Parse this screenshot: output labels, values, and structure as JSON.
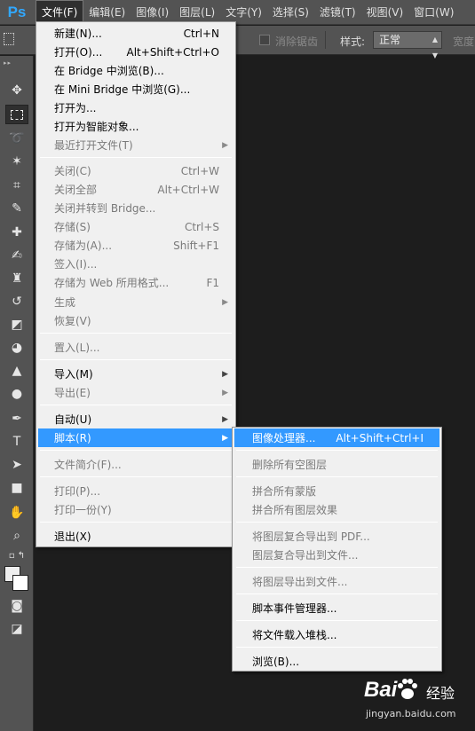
{
  "app": {
    "logo": "Ps"
  },
  "menubar": {
    "items": [
      "文件(F)",
      "编辑(E)",
      "图像(I)",
      "图层(L)",
      "文字(Y)",
      "选择(S)",
      "滤镜(T)",
      "视图(V)",
      "窗口(W)"
    ]
  },
  "options": {
    "antialias_label": "消除锯齿",
    "style_label": "样式:",
    "style_value": "正常",
    "width_label": "宽度"
  },
  "toolbox": {
    "icons": [
      "move-icon",
      "marquee-icon",
      "lasso-icon",
      "magic-wand-icon",
      "crop-icon",
      "eyedropper-icon",
      "healing-brush-icon",
      "brush-icon",
      "clone-stamp-icon",
      "history-brush-icon",
      "eraser-icon",
      "paint-bucket-icon",
      "blur-icon",
      "dodge-icon",
      "pen-icon",
      "type-icon",
      "path-selection-icon",
      "rectangle-icon",
      "hand-icon",
      "zoom-icon",
      "swap-colors-icon",
      "quick-mask-icon",
      "screen-mode-icon"
    ],
    "foreground_color": "#eeeeee",
    "background_color": "#ffffff"
  },
  "file_menu": {
    "items": [
      {
        "label": "新建(N)...",
        "shortcut": "Ctrl+N",
        "enabled": true
      },
      {
        "label": "打开(O)...",
        "shortcut": "Alt+Shift+Ctrl+O",
        "enabled": true
      },
      {
        "label": "在 Bridge 中浏览(B)...",
        "shortcut": "",
        "enabled": true
      },
      {
        "label": "在 Mini Bridge 中浏览(G)...",
        "shortcut": "",
        "enabled": true
      },
      {
        "label": "打开为...",
        "shortcut": "",
        "enabled": true
      },
      {
        "label": "打开为智能对象...",
        "shortcut": "",
        "enabled": true
      },
      {
        "label": "最近打开文件(T)",
        "shortcut": "",
        "enabled": false,
        "submenu": true
      },
      {
        "label": "关闭(C)",
        "shortcut": "Ctrl+W",
        "enabled": false
      },
      {
        "label": "关闭全部",
        "shortcut": "Alt+Ctrl+W",
        "enabled": false
      },
      {
        "label": "关闭并转到 Bridge...",
        "shortcut": "",
        "enabled": false
      },
      {
        "label": "存储(S)",
        "shortcut": "Ctrl+S",
        "enabled": false
      },
      {
        "label": "存储为(A)...",
        "shortcut": "Shift+F1",
        "enabled": false
      },
      {
        "label": "签入(I)...",
        "shortcut": "",
        "enabled": false
      },
      {
        "label": "存储为 Web 所用格式...",
        "shortcut": "F1",
        "enabled": false
      },
      {
        "label": "生成",
        "shortcut": "",
        "enabled": false,
        "submenu": true
      },
      {
        "label": "恢复(V)",
        "shortcut": "",
        "enabled": false
      },
      {
        "label": "置入(L)...",
        "shortcut": "",
        "enabled": false
      },
      {
        "label": "导入(M)",
        "shortcut": "",
        "enabled": true,
        "submenu": true
      },
      {
        "label": "导出(E)",
        "shortcut": "",
        "enabled": false,
        "submenu": true
      },
      {
        "label": "自动(U)",
        "shortcut": "",
        "enabled": true,
        "submenu": true
      },
      {
        "label": "脚本(R)",
        "shortcut": "",
        "enabled": true,
        "submenu": true,
        "highlighted": true
      },
      {
        "label": "文件简介(F)...",
        "shortcut": "",
        "enabled": false
      },
      {
        "label": "打印(P)...",
        "shortcut": "",
        "enabled": false
      },
      {
        "label": "打印一份(Y)",
        "shortcut": "",
        "enabled": false
      },
      {
        "label": "退出(X)",
        "shortcut": "",
        "enabled": true
      }
    ]
  },
  "script_menu": {
    "items": [
      {
        "label": "图像处理器...",
        "shortcut": "Alt+Shift+Ctrl+I",
        "enabled": true,
        "highlighted": true
      },
      {
        "label": "删除所有空图层",
        "shortcut": "",
        "enabled": false
      },
      {
        "label": "拼合所有蒙版",
        "shortcut": "",
        "enabled": false
      },
      {
        "label": "拼合所有图层效果",
        "shortcut": "",
        "enabled": false
      },
      {
        "label": "将图层复合导出到 PDF...",
        "shortcut": "",
        "enabled": false
      },
      {
        "label": "图层复合导出到文件...",
        "shortcut": "",
        "enabled": false
      },
      {
        "label": "将图层导出到文件...",
        "shortcut": "",
        "enabled": false
      },
      {
        "label": "脚本事件管理器...",
        "shortcut": "",
        "enabled": true
      },
      {
        "label": "将文件载入堆栈...",
        "shortcut": "",
        "enabled": true
      },
      {
        "label": "浏览(B)...",
        "shortcut": "",
        "enabled": true
      }
    ]
  },
  "watermark": {
    "logo": "Bai",
    "logo_suffix": "经验",
    "url": "jingyan.baidu.com"
  },
  "colors": {
    "highlight": "#3399ff",
    "menu_bg": "#f0f0f0",
    "app_bg": "#1d1d1d",
    "panel": "#535353"
  }
}
